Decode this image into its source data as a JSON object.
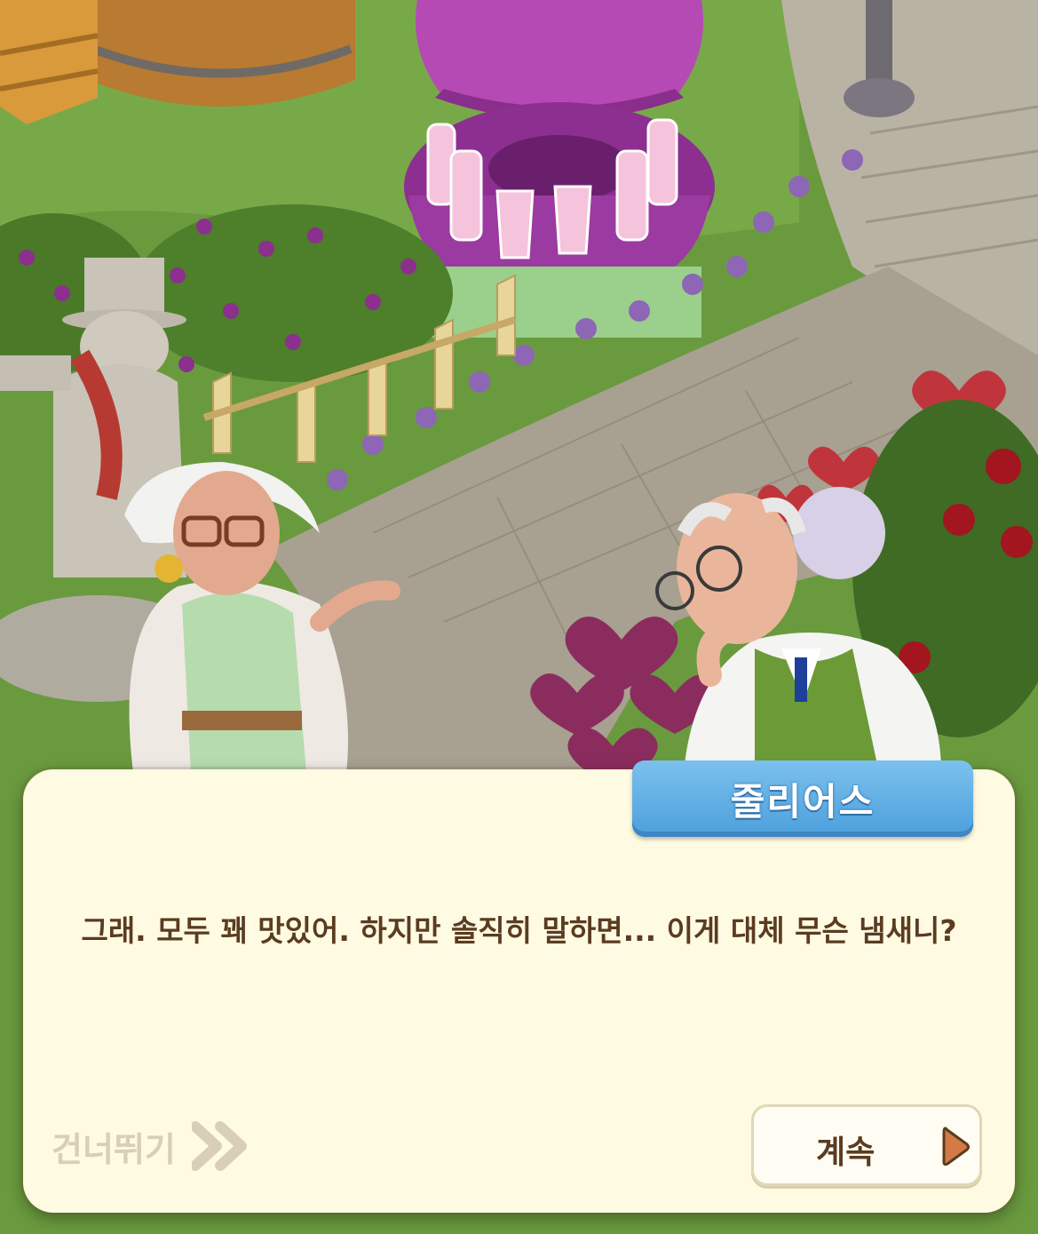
{
  "dialog": {
    "speaker": "줄리어스",
    "text": "그래. 모두 꽤 맛있어. 하지만 솔직히 말하면... 이게 대체 무슨 냄새니?",
    "skip_label": "건너뛰기",
    "continue_label": "계속"
  },
  "icons": {
    "skip": "double-chevron-right-icon",
    "continue": "play-triangle-icon"
  },
  "colors": {
    "dialog_bg": "#fffbe2",
    "name_tag": "#5aa9e2",
    "text": "#5a3c20",
    "skip_text": "#d8cfb6"
  }
}
